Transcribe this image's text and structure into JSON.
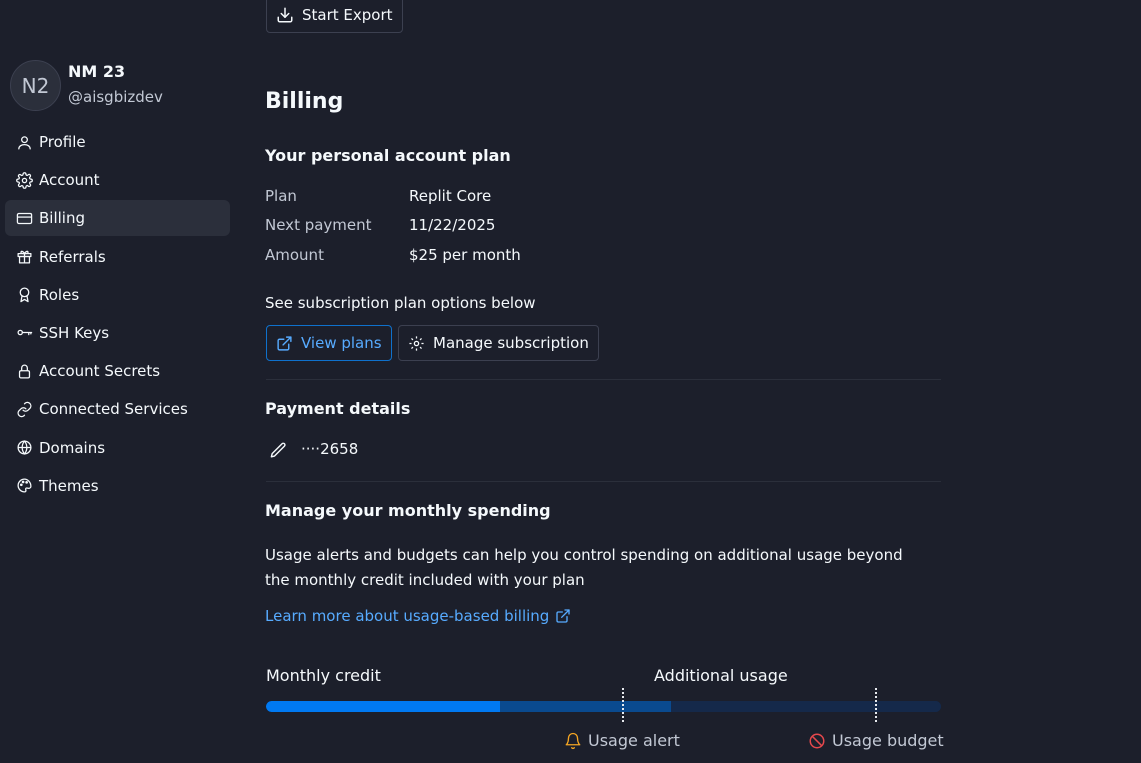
{
  "export": {
    "button_label": "Start Export",
    "icon": "download-icon"
  },
  "user": {
    "avatar_initials": "N2",
    "name": "NM 23",
    "handle": "@aisgbizdev"
  },
  "sidebar": {
    "items": [
      {
        "label": "Profile",
        "icon": "person-icon",
        "active": false
      },
      {
        "label": "Account",
        "icon": "gear-icon",
        "active": false
      },
      {
        "label": "Billing",
        "icon": "credit-card-icon",
        "active": true
      },
      {
        "label": "Referrals",
        "icon": "gift-icon",
        "active": false
      },
      {
        "label": "Roles",
        "icon": "badge-icon",
        "active": false
      },
      {
        "label": "SSH Keys",
        "icon": "key-icon",
        "active": false
      },
      {
        "label": "Account Secrets",
        "icon": "lock-icon",
        "active": false
      },
      {
        "label": "Connected Services",
        "icon": "link-icon",
        "active": false
      },
      {
        "label": "Domains",
        "icon": "globe-icon",
        "active": false
      },
      {
        "label": "Themes",
        "icon": "palette-icon",
        "active": false
      }
    ]
  },
  "billing": {
    "title": "Billing",
    "plan_section": {
      "heading": "Your personal account plan",
      "rows": [
        {
          "label": "Plan",
          "value": "Replit Core"
        },
        {
          "label": "Next payment",
          "value": "11/22/2025"
        },
        {
          "label": "Amount",
          "value": "$25 per month"
        }
      ],
      "options_text": "See subscription plan options below",
      "view_plans_label": "View plans",
      "manage_subscription_label": "Manage subscription"
    },
    "payment_section": {
      "heading": "Payment details",
      "card_masked": "····2658"
    },
    "spending_section": {
      "heading": "Manage your monthly spending",
      "description": "Usage alerts and budgets can help you control spending on additional usage beyond the monthly credit included with your plan",
      "learn_more_link": "Learn more about usage-based billing",
      "usage_bar": {
        "monthly_credit_label": "Monthly credit",
        "additional_usage_label": "Additional usage",
        "credit_used_fraction": 0.347,
        "credit_end_fraction": 0.6,
        "usage_alert_label": "Usage alert",
        "usage_budget_label": "Usage budget",
        "alert_color": "#f5a623",
        "budget_color": "#e5484d",
        "fill_color": "#0079f2"
      }
    }
  }
}
